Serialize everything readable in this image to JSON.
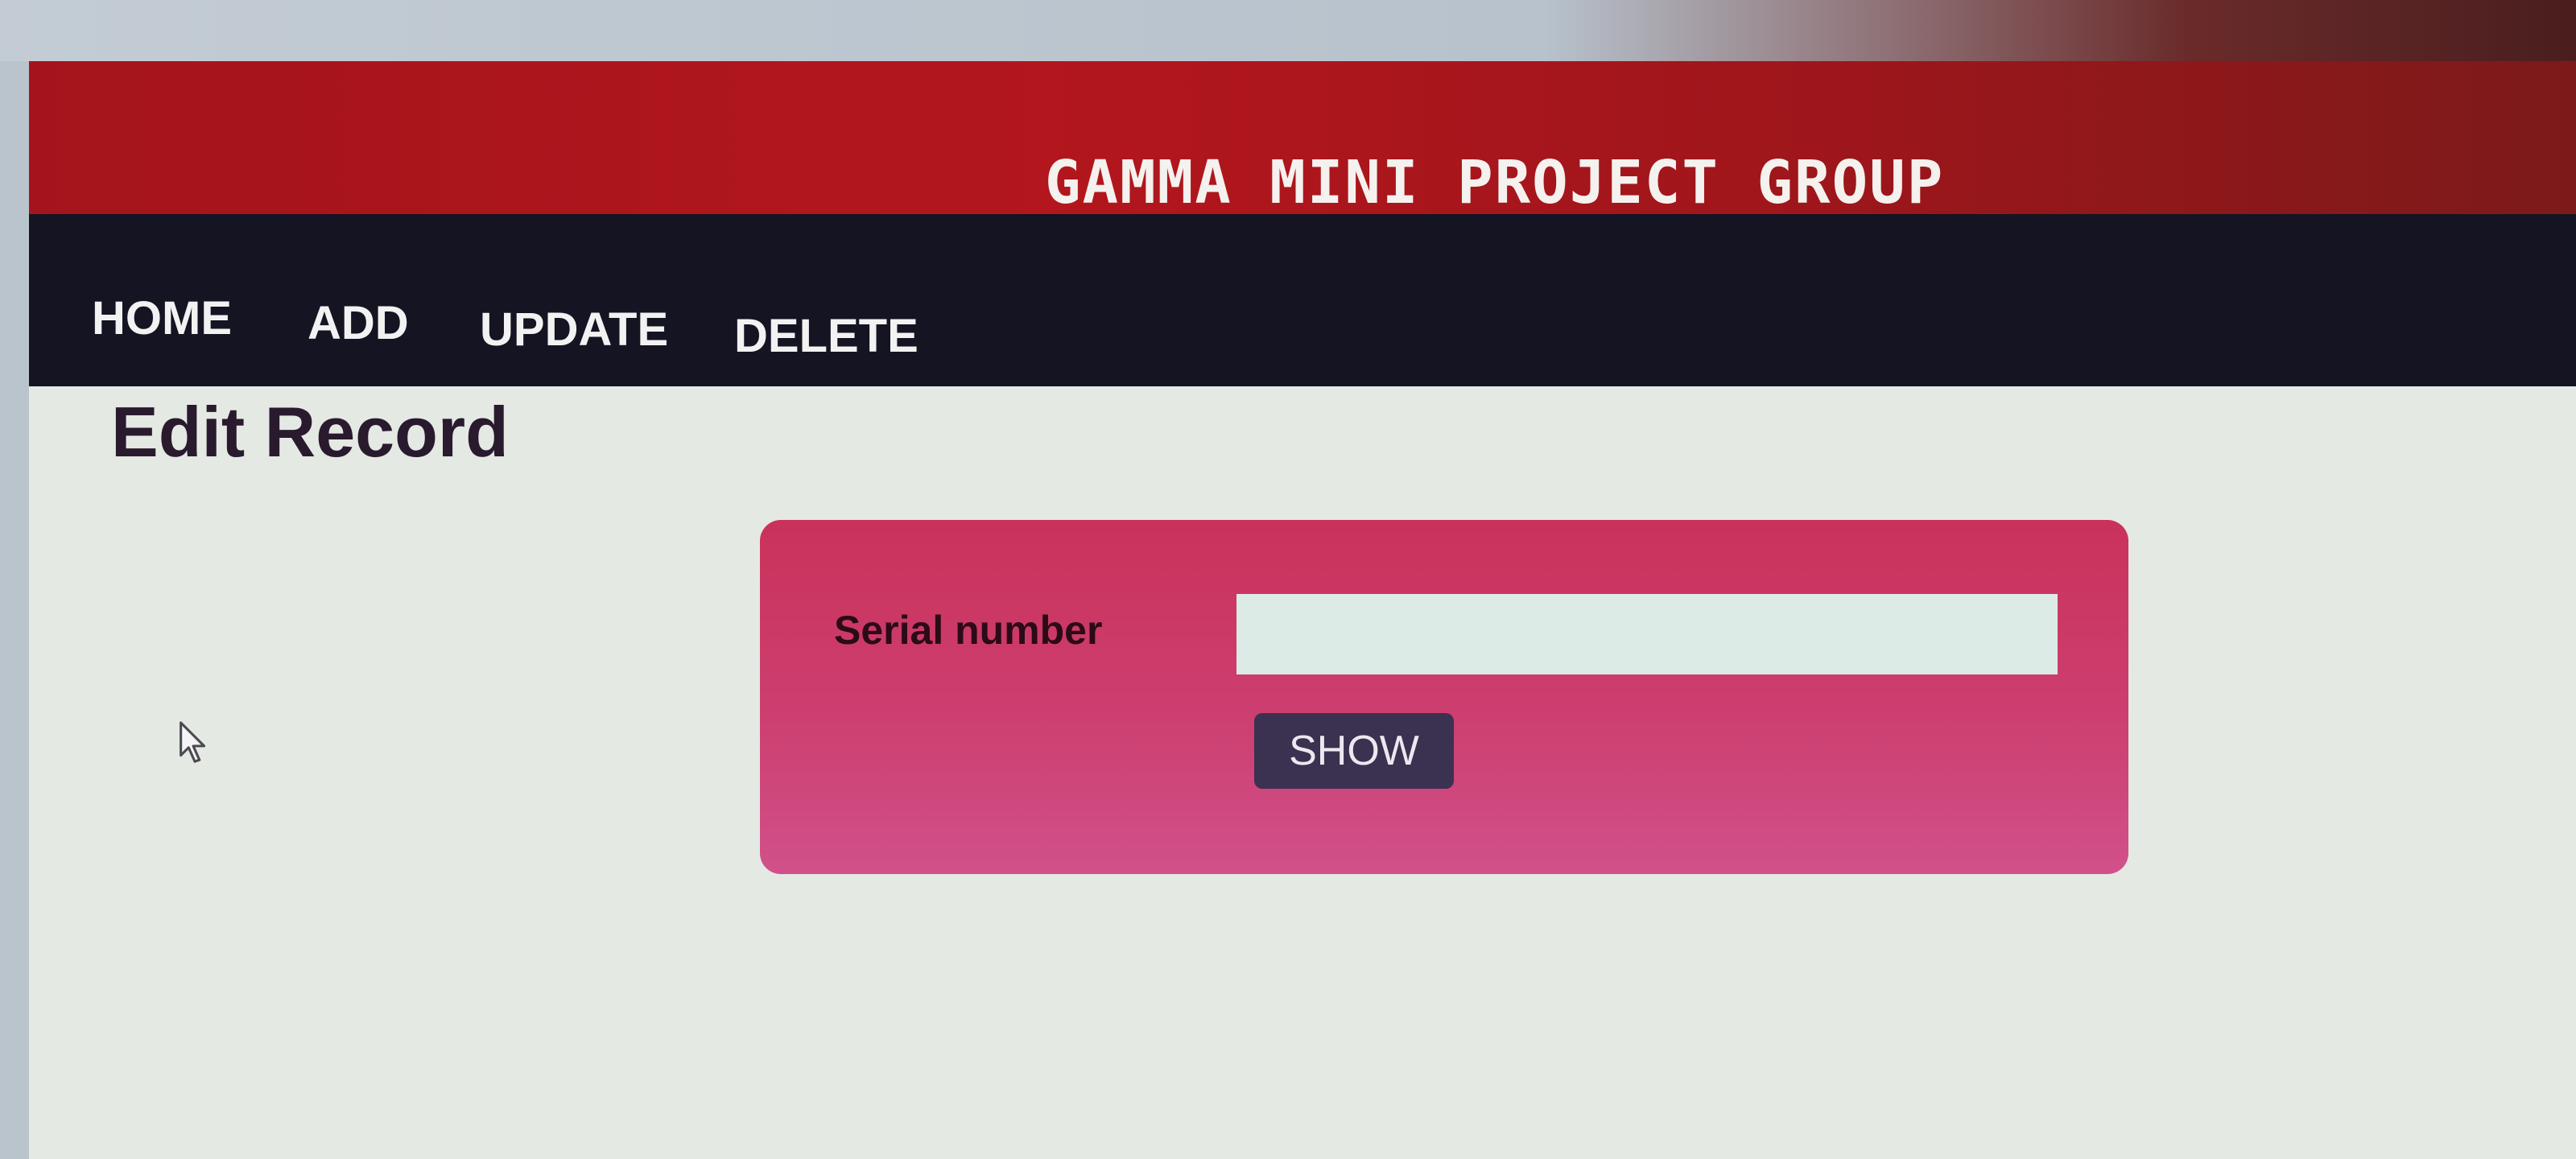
{
  "header": {
    "site_title": "GAMMA MINI PROJECT GROUP"
  },
  "nav": {
    "items": [
      {
        "label": "HOME"
      },
      {
        "label": "ADD"
      },
      {
        "label": "UPDATE"
      },
      {
        "label": "DELETE"
      }
    ]
  },
  "main": {
    "page_title": "Edit Record",
    "form": {
      "serial_label": "Serial number",
      "serial_value": "",
      "show_button": "SHOW"
    }
  },
  "colors": {
    "header_bg": "#a5141c",
    "nav_bg": "#141422",
    "panel_bg": "#cd4072",
    "button_bg": "#3b3150",
    "page_bg": "#e4e9e3"
  },
  "icons": {
    "cursor": "mouse-pointer-icon"
  }
}
